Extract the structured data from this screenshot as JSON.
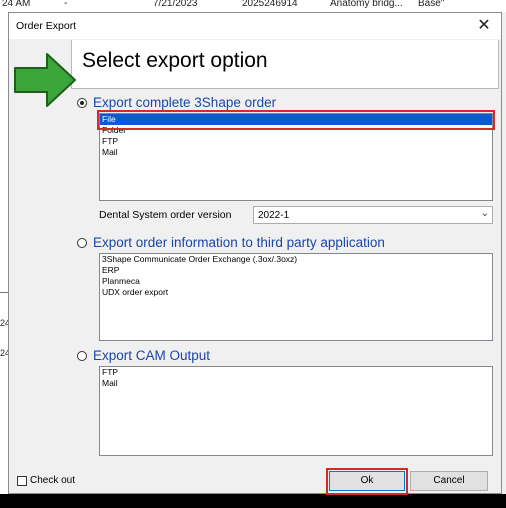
{
  "background": {
    "top_row": [
      "24 AM",
      "-",
      "7/21/2023",
      "2025246914",
      "Anatomy bridg...",
      "Base\""
    ],
    "left_fragments": [
      "24",
      "24"
    ]
  },
  "dialog": {
    "title": "Order Export",
    "close_glyph": "✕",
    "heading": "Select export option"
  },
  "option_complete": {
    "label": "Export complete 3Shape order",
    "selected": true,
    "items": [
      "File",
      "Folder",
      "FTP",
      "Mail"
    ],
    "selected_item": "File"
  },
  "version": {
    "label": "Dental System order version",
    "value": "2022-1"
  },
  "option_third_party": {
    "label": "Export order information to third party application",
    "selected": false,
    "items": [
      "3Shape Communicate Order Exchange (.3ox/.3oxz)",
      "ERP",
      "Planmeca",
      "UDX order export"
    ]
  },
  "option_cam": {
    "label": "Export CAM Output",
    "selected": false,
    "items": [
      "FTP",
      "Mail"
    ]
  },
  "footer": {
    "checkout_label": "Check out",
    "ok_label": "Ok",
    "cancel_label": "Cancel"
  },
  "colors": {
    "accent": "#0a5ad6",
    "option_text": "#1a46a6",
    "highlight_box": "#d42a2a",
    "arrow_green": "#3da63a"
  }
}
